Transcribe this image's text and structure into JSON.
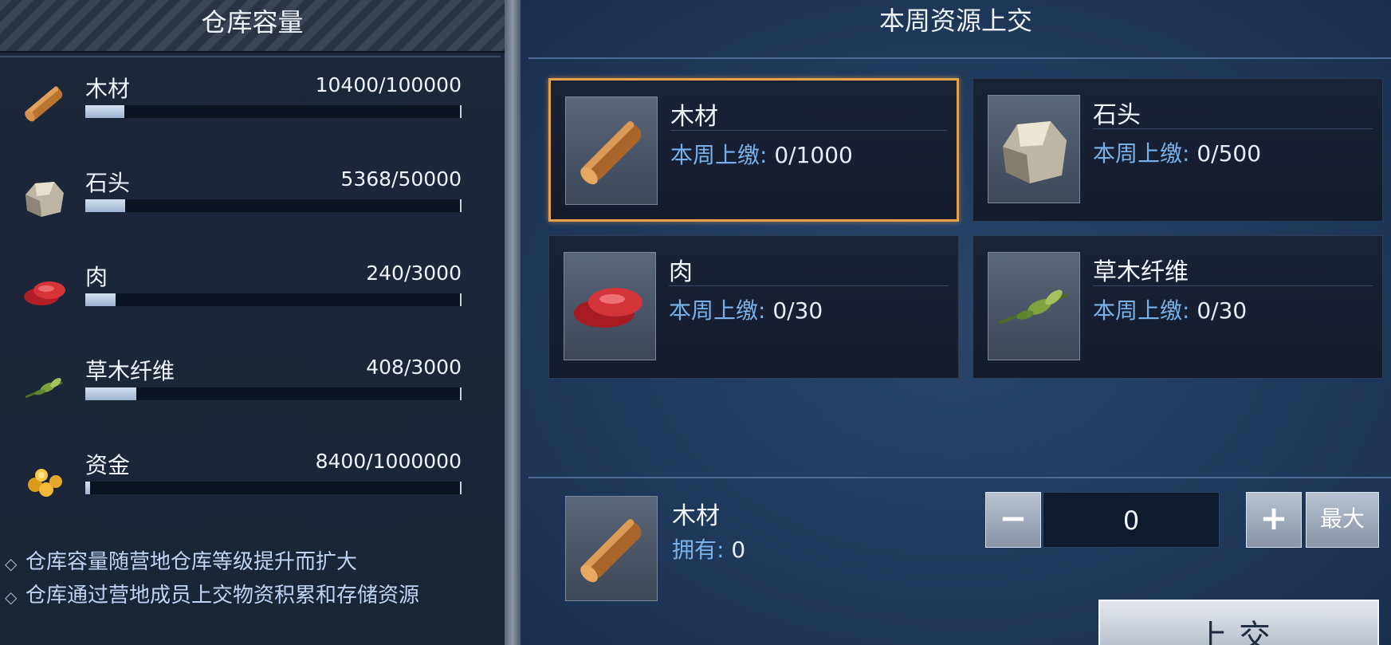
{
  "left": {
    "title": "仓库容量",
    "resources": [
      {
        "name": "木材",
        "amount": "10400/100000",
        "fill": 0.104,
        "icon": "wood-icon"
      },
      {
        "name": "石头",
        "amount": "5368/50000",
        "fill": 0.107,
        "icon": "stone-icon"
      },
      {
        "name": "肉",
        "amount": "240/3000",
        "fill": 0.08,
        "icon": "meat-icon"
      },
      {
        "name": "草木纤维",
        "amount": "408/3000",
        "fill": 0.136,
        "icon": "fiber-icon"
      },
      {
        "name": "资金",
        "amount": "8400/1000000",
        "fill": 0.0084,
        "icon": "coins-icon"
      }
    ],
    "notes": [
      "仓库容量随营地仓库等级提升而扩大",
      "仓库通过营地成员上交物资积累和存储资源"
    ],
    "bullet": "◇"
  },
  "right": {
    "title": "本周资源上交",
    "quota_label": "本周上缴:",
    "cards": [
      {
        "name": "木材",
        "quota": "0/1000",
        "icon": "wood-icon",
        "selected": true
      },
      {
        "name": "石头",
        "quota": "0/500",
        "icon": "stone-icon",
        "selected": false
      },
      {
        "name": "肉",
        "quota": "0/30",
        "icon": "meat-icon",
        "selected": false
      },
      {
        "name": "草木纤维",
        "quota": "0/30",
        "icon": "fiber-icon",
        "selected": false
      }
    ],
    "selected": {
      "name": "木材",
      "owned_label": "拥有:",
      "owned_value": "0"
    },
    "stepper": {
      "minus": "−",
      "plus": "+",
      "value": "0",
      "max_label": "最大"
    },
    "submit_label": "上交"
  },
  "colors": {
    "accent_orange": "#e8a04a",
    "quota_blue": "#78b1ea",
    "panel_bg": "#1c2739",
    "right_bg": "#213a5d"
  }
}
